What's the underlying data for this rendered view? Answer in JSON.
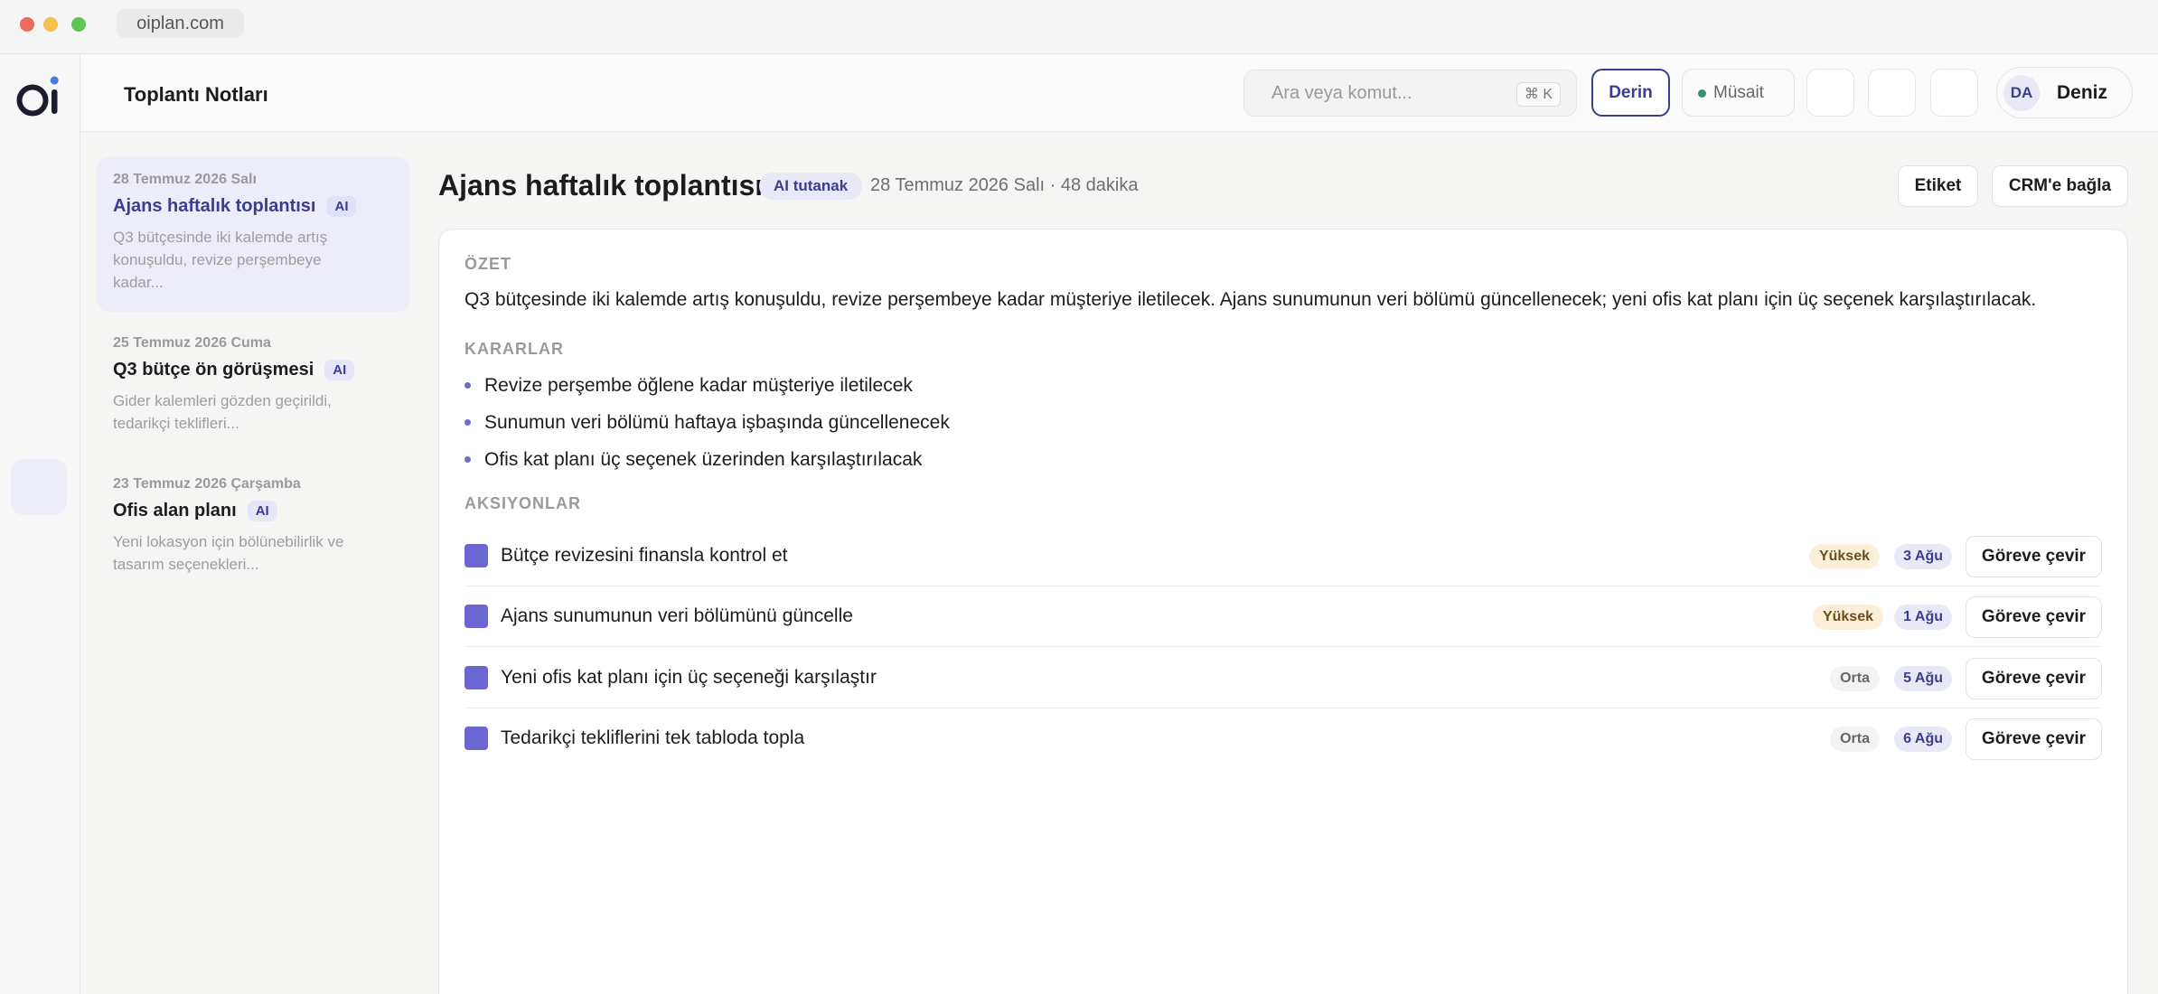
{
  "browser": {
    "url": "oiplan.com"
  },
  "topbar": {
    "title": "Toplantı Notları",
    "search_placeholder": "Ara veya komut...",
    "search_shortcut": "⌘ K",
    "mode_button": "Derin",
    "status_label": "Müsait",
    "status_color": "#3c8f6b",
    "user_initials": "DA",
    "user_name": "Deniz"
  },
  "notes": [
    {
      "date": "28 Temmuz 2026 Salı",
      "title": "Ajans haftalık toplantısı",
      "tag": "AI",
      "snippet": "Q3 bütçesinde iki kalemde artış konuşuldu, revize perşembeye kadar...",
      "active": true
    },
    {
      "date": "25 Temmuz 2026 Cuma",
      "title": "Q3 bütçe ön görüşmesi",
      "tag": "AI",
      "snippet": "Gider kalemleri gözden geçirildi, tedarikçi teklifleri...",
      "active": false
    },
    {
      "date": "23 Temmuz 2026 Çarşamba",
      "title": "Ofis alan planı",
      "tag": "AI",
      "snippet": "Yeni lokasyon için bölünebilirlik ve tasarım seçenekleri...",
      "active": false
    }
  ],
  "note": {
    "title": "Ajans haftalık toplantısı",
    "tag": "AI tutanak",
    "meta": "28 Temmuz 2026 Salı · 48 dakika",
    "label_button": "Etiket",
    "crm_button": "CRM'e bağla",
    "summary_label": "ÖZET",
    "summary": "Q3 bütçesinde iki kalemde artış konuşuldu, revize perşembeye kadar müşteriye iletilecek. Ajans sunumunun veri bölümü güncellenecek; yeni ofis kat planı için üç seçenek karşılaştırılacak.",
    "decisions_label": "KARARLAR",
    "decisions": [
      "Revize perşembe öğlene kadar müşteriye iletilecek",
      "Sunumun veri bölümü haftaya işbaşında güncellenecek",
      "Ofis kat planı üç seçenek üzerinden karşılaştırılacak"
    ],
    "actions_label": "AKSIYONLAR",
    "actions": [
      {
        "text": "Bütçe revizesini finansla kontrol et",
        "priority": "Yüksek",
        "due": "3 Ağu",
        "button": "Göreve çevir"
      },
      {
        "text": "Ajans sunumunun veri bölümünü güncelle",
        "priority": "Yüksek",
        "due": "1 Ağu",
        "button": "Göreve çevir"
      },
      {
        "text": "Yeni ofis kat planı için üç seçeneği karşılaştır",
        "priority": "Orta",
        "due": "5 Ağu",
        "button": "Göreve çevir"
      },
      {
        "text": "Tedarikçi tekliflerini tek tabloda topla",
        "priority": "Orta",
        "due": "6 Ağu",
        "button": "Göreve çevir"
      }
    ]
  }
}
